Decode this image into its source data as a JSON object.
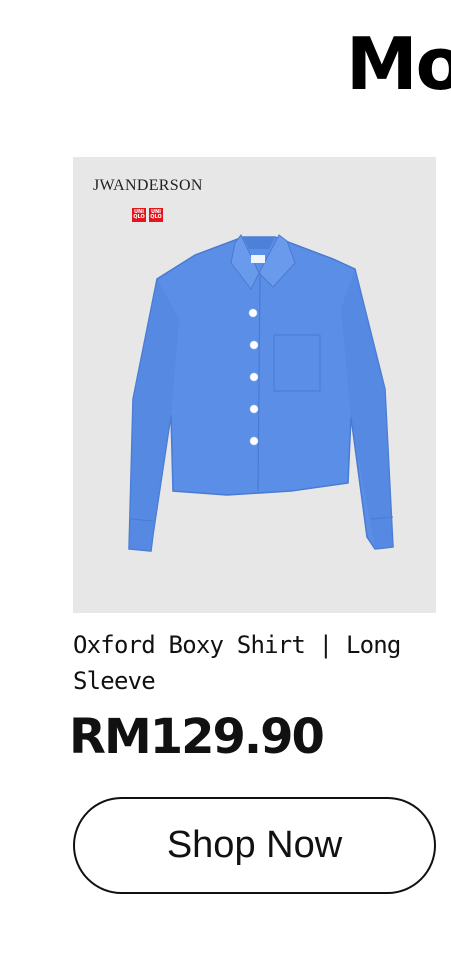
{
  "header": {
    "title": "Mo"
  },
  "product": {
    "brand_logo_text": "JWANDERSON",
    "uniqlo_logo_left": "UNI QLO",
    "uniqlo_logo_right": "UNI QLO",
    "name": "Oxford Boxy Shirt | Long Sleeve",
    "price": "RM129.90",
    "image_subject": "blue-oxford-shirt",
    "shirt_color": "#5b8ee6",
    "image_background": "#e7e7e7"
  },
  "cta": {
    "shop_label": "Shop Now"
  },
  "colors": {
    "uniqlo_red": "#e3161e",
    "text": "#111111"
  }
}
